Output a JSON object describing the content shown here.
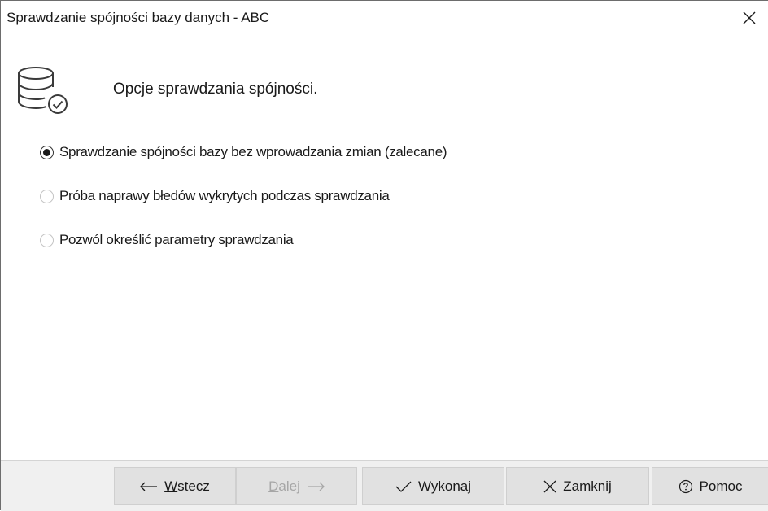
{
  "window": {
    "title": "Sprawdzanie spójności bazy danych - ABC",
    "close_icon": "close-icon"
  },
  "header": {
    "icon": "database-check-icon",
    "title": "Opcje sprawdzania spójności."
  },
  "options": [
    {
      "label": "Sprawdzanie spójności bazy bez wprowadzania zmian (zalecane)",
      "selected": true
    },
    {
      "label": "Próba naprawy błedów wykrytych podczas sprawdzania",
      "selected": false
    },
    {
      "label": "Pozwól określić parametry sprawdzania",
      "selected": false
    }
  ],
  "footer": {
    "back": {
      "accel": "W",
      "rest": "stecz",
      "icon": "arrow-left-icon",
      "enabled": true
    },
    "next": {
      "accel": "D",
      "rest": "alej",
      "icon": "arrow-right-icon",
      "enabled": false
    },
    "execute": {
      "label": "Wykonaj",
      "icon": "check-icon",
      "enabled": true
    },
    "close": {
      "label": "Zamknij",
      "icon": "close-icon",
      "enabled": true
    },
    "help": {
      "label": "Pomoc",
      "icon": "help-circle-icon",
      "enabled": true
    }
  }
}
